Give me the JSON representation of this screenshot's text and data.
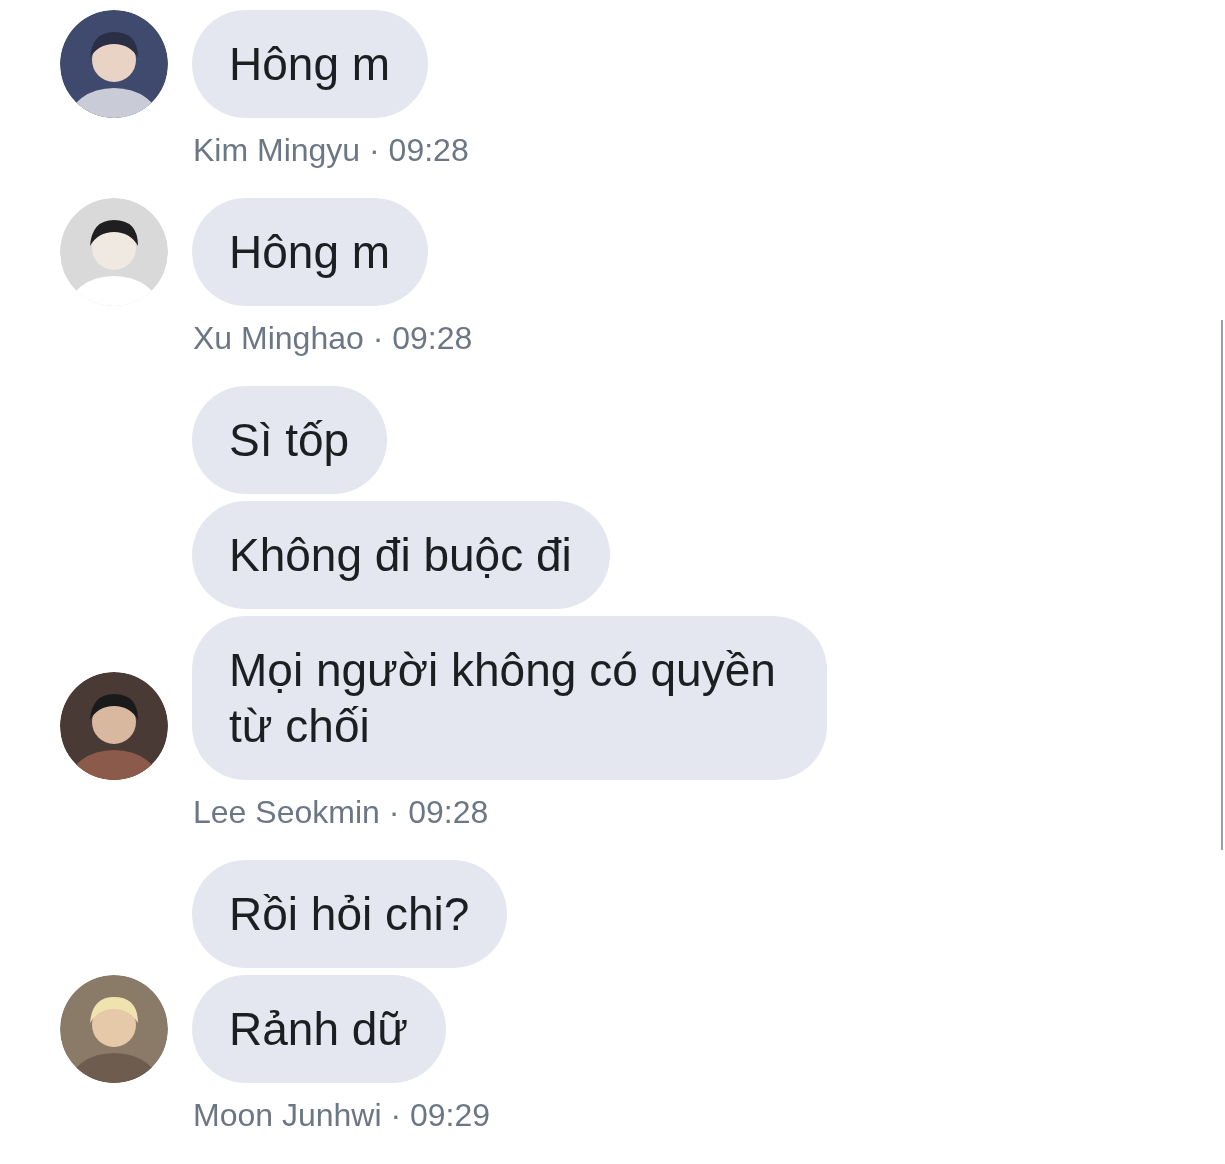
{
  "groups": [
    {
      "messages": [
        "Hông m"
      ],
      "meta": "Kim Mingyu · 09:28"
    },
    {
      "messages": [
        "Hông m"
      ],
      "meta": "Xu Minghao · 09:28"
    },
    {
      "messages": [
        "Sì tốp",
        "Không đi buộc đi",
        "Mọi người không có quyền từ chối"
      ],
      "meta": "Lee Seokmin · 09:28"
    },
    {
      "messages": [
        "Rồi hỏi chi?",
        "Rảnh dữ"
      ],
      "meta": "Moon Junhwi · 09:29"
    }
  ]
}
